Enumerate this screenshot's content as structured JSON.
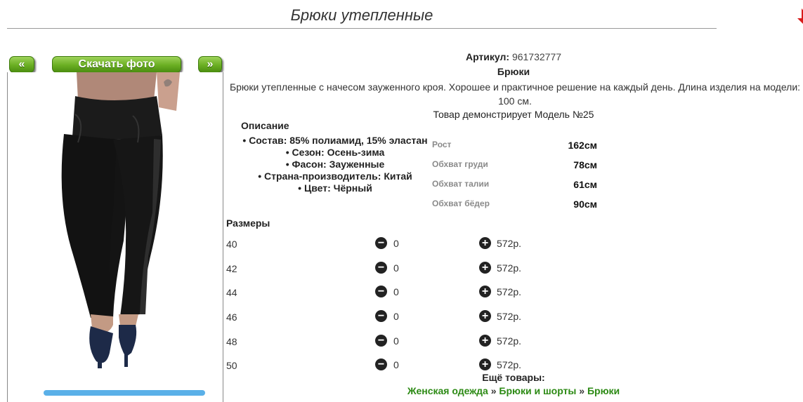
{
  "header": {
    "title": "Брюки утепленные"
  },
  "gallery": {
    "prev_label": "«",
    "download_label": "Скачать фото",
    "next_label": "»"
  },
  "product": {
    "article_label": "Артикул:",
    "article_value": "961732777",
    "category": "Брюки",
    "description": "Брюки утепленные с начесом зауженного кроя. Хорошее и практичное решение на каждый день. Длина изделия на модели: 100 см.",
    "model_note": "Товар демонстрирует Модель №25"
  },
  "specs": {
    "heading": "Описание",
    "items": [
      "Состав: 85% полиамид, 15% эластан",
      "Сезон: Осень-зима",
      "Фасон: Зауженные",
      "Страна-производитель: Китай",
      "Цвет: Чёрный"
    ]
  },
  "measurements": [
    {
      "label": "Рост",
      "value": "162см"
    },
    {
      "label": "Обхват груди",
      "value": "78см"
    },
    {
      "label": "Обхват талии",
      "value": "61см"
    },
    {
      "label": "Обхват бёдер",
      "value": "90см"
    }
  ],
  "sizes": {
    "heading": "Размеры",
    "rows": [
      {
        "size": "40",
        "qty": "0",
        "price": "572р."
      },
      {
        "size": "42",
        "qty": "0",
        "price": "572р."
      },
      {
        "size": "44",
        "qty": "0",
        "price": "572р."
      },
      {
        "size": "46",
        "qty": "0",
        "price": "572р."
      },
      {
        "size": "48",
        "qty": "0",
        "price": "572р."
      },
      {
        "size": "50",
        "qty": "0",
        "price": "572р."
      }
    ]
  },
  "more": {
    "heading": "Ещё товары:",
    "crumbs": [
      "Женская одежда",
      "Брюки и шорты",
      "Брюки"
    ],
    "separator": "»"
  },
  "colors": {
    "button_green": "#6aae22",
    "link_green": "#2c8a14",
    "logo_red": "#d81a1a"
  }
}
